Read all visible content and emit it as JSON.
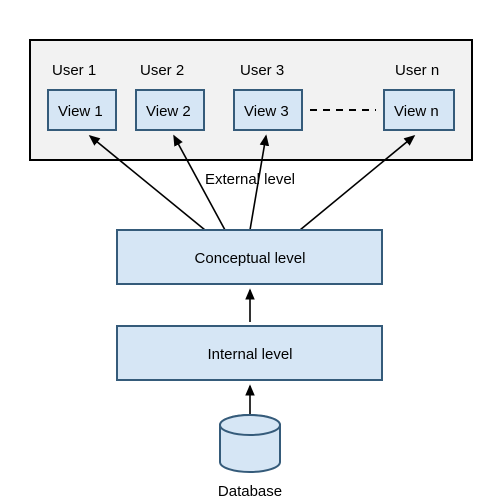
{
  "external": {
    "title": "External level",
    "users": [
      {
        "user_label": "User 1",
        "view_label": "View 1"
      },
      {
        "user_label": "User 2",
        "view_label": "View 2"
      },
      {
        "user_label": "User 3",
        "view_label": "View 3"
      },
      {
        "user_label": "User n",
        "view_label": "View n"
      }
    ]
  },
  "conceptual": {
    "label": "Conceptual level"
  },
  "internal": {
    "label": "Internal level"
  },
  "database": {
    "label": "Database"
  },
  "colors": {
    "box_fill": "#d6e6f5",
    "box_stroke": "#355b7a",
    "ext_fill": "#f2f2f2"
  }
}
